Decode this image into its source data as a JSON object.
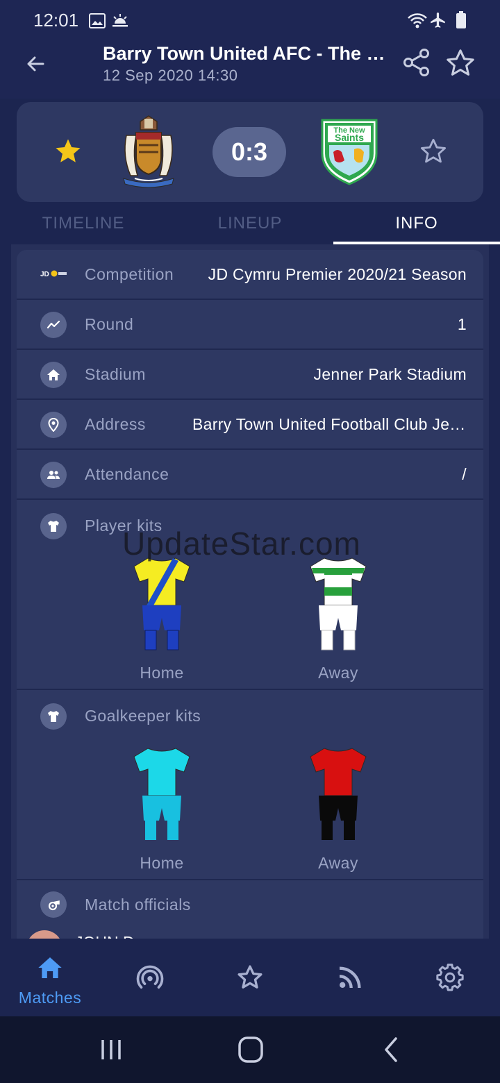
{
  "status_bar": {
    "time": "12:01"
  },
  "header": {
    "title": "Barry Town United AFC - The New Saints",
    "subtitle": "12 Sep 2020 14:30"
  },
  "score_card": {
    "score": "0:3",
    "home_team_crest": "barry-town-crest",
    "away_team_crest": "the-new-saints-crest",
    "away_crest_text_top": "The New",
    "away_crest_text_main": "Saints"
  },
  "tabs": [
    {
      "label": "TIMELINE",
      "active": false
    },
    {
      "label": "LINEUP",
      "active": false
    },
    {
      "label": "INFO",
      "active": true
    }
  ],
  "info": {
    "competition": {
      "label": "Competition",
      "value": "JD Cymru Premier 2020/21 Season",
      "logo_text": "JD"
    },
    "round": {
      "label": "Round",
      "value": "1"
    },
    "stadium": {
      "label": "Stadium",
      "value": "Jenner Park Stadium"
    },
    "address": {
      "label": "Address",
      "value": "Barry Town United Football Club Jenner Park"
    },
    "attendance": {
      "label": "Attendance",
      "value": "/"
    },
    "player_kits": {
      "label": "Player kits",
      "home_label": "Home",
      "away_label": "Away"
    },
    "goalkeeper_kits": {
      "label": "Goalkeeper kits",
      "home_label": "Home",
      "away_label": "Away"
    },
    "officials": {
      "label": "Match officials",
      "first_name": "JOHN D..."
    }
  },
  "watermark": "UpdateStar.com",
  "bottom_nav": [
    {
      "label": "Matches",
      "icon": "home-icon",
      "active": true
    },
    {
      "label": "",
      "icon": "live-icon",
      "active": false
    },
    {
      "label": "",
      "icon": "star-icon",
      "active": false
    },
    {
      "label": "",
      "icon": "rss-icon",
      "active": false
    },
    {
      "label": "",
      "icon": "gear-icon",
      "active": false
    }
  ],
  "colors": {
    "background": "#1c2550",
    "card": "#2e3862",
    "accent": "#4e9bf5",
    "star": "#f5c518",
    "muted_text": "#9aa3c4"
  }
}
